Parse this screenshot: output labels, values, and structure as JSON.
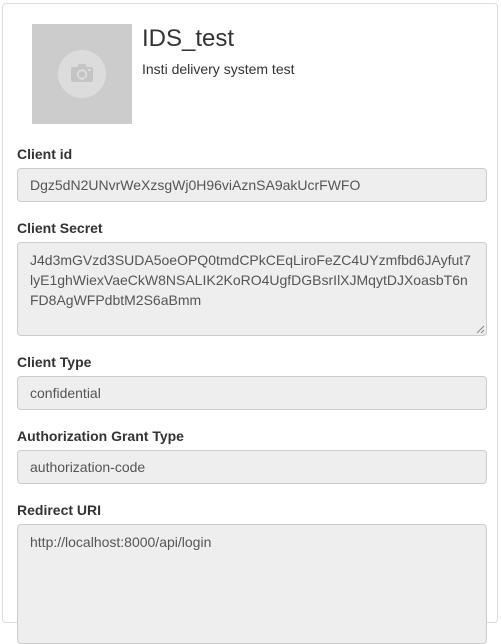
{
  "app": {
    "name": "IDS_test",
    "description": "Insti delivery system test",
    "logo_icon": "camera-icon"
  },
  "fields": {
    "client_id": {
      "label": "Client id",
      "value": "Dgz5dN2UNvrWeXzsgWj0H96viAznSA9akUcrFWFO"
    },
    "client_secret": {
      "label": "Client Secret",
      "value": "J4d3mGVzd3SUDA5oeOPQ0tmdCPkCEqLiroFeZC4UYzmfbd6JAyfut7lyE1ghWiexVaeCkW8NSALIK2KoRO4UgfDGBsrIlXJMqytDJXoasbT6nFD8AgWFPdbtM2S6aBmm"
    },
    "client_type": {
      "label": "Client Type",
      "value": "confidential"
    },
    "grant_type": {
      "label": "Authorization Grant Type",
      "value": "authorization-code"
    },
    "redirect_uri": {
      "label": "Redirect URI",
      "value": "http://localhost:8000/api/login"
    }
  },
  "colors": {
    "field_background": "#eeeeee",
    "field_border": "#cccccc",
    "logo_background": "#cccccc"
  }
}
